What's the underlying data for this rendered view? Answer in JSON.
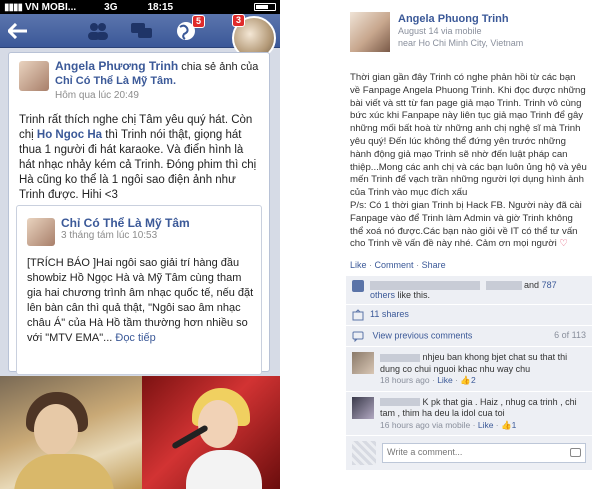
{
  "phone": {
    "status": {
      "carrier": "VN MOBI...",
      "network": "3G",
      "time": "18:15"
    },
    "badges": {
      "notifications": "5",
      "profile": "3"
    },
    "post": {
      "author": "Angela Phương Trinh",
      "action": "chia sẻ ảnh của",
      "page": "Chỉ Có Thể Là Mỹ Tâm.",
      "time": "Hôm qua lúc 20:49",
      "text_1": "Trinh rất thích nghe chị Tâm yêu quý hát. Còn chị",
      "text_highlight": "Ho Ngoc Ha",
      "text_2": "thì Trinh nói thật, giọng hát thua 1 người đi hát karaoke. Và điển hình là hát nhạc nhảy kém cả Trinh. Đóng phim thì chị Hà cũng ko thể là 1 ngôi sao điện ảnh như Trinh được. Hihi <3"
    },
    "shared": {
      "name": "Chỉ Có Thể Là Mỹ Tâm",
      "time": "3 tháng tám lúc 10:53",
      "text": "[TRÍCH BÁO ]Hai ngôi sao giải trí hàng đầu showbiz Hồ Ngọc Hà và Mỹ Tâm cùng tham gia hai chương trình âm nhạc quốc tế, nếu đặt lên bàn cân thì quả thật, \"Ngôi sao âm nhạc châu Á\" của Hà Hồ tầm thường hơn nhiều so với \"MTV EMA\"...",
      "more": "Đọc tiếp"
    }
  },
  "post": {
    "author": "Angela Phuong Trinh",
    "date": "August 14 via mobile",
    "location": "near Ho Chi Minh City, Vietnam",
    "body": "Thời gian gần đây Trinh có nghe phản hồi từ các bạn về Fanpage Angela Phuong Trinh. Khi đọc được những bài viết và stt từ fan page giả mạo Trinh. Trinh vô cùng bức xúc khi Fanpape này liên tục giả mạo Trinh để gây những mối bất hoà từ những anh chị nghệ sĩ mà Trinh yêu quý! Đến lúc không thể đứng yên trước những hành động giả mạo Trinh sẽ nhờ đến luật pháp can thiệp...Mong các anh chị và các bạn luôn ủng hộ và yêu mến Trinh để vạch trần những người lợi dụng hình ảnh của Trinh vào mục đích xấu",
    "ps": "P/s: Có 1 thời gian Trinh bị Hack FB. Người này đã cài Fanpage vào để Trinh làm Admin và giờ Trinh không thể xoá nó được.Các bạn nào giỏi về IT có thể tư vấn cho Trinh về vấn đề này nhé. Cảm ơn mọi người",
    "actions": {
      "like": "Like",
      "comment": "Comment",
      "share": "Share",
      "dot": "·"
    },
    "likes": {
      "and": "and",
      "count": "787",
      "others": "others",
      "tail": "like this."
    },
    "shares": "11 shares",
    "view_previous": "View previous comments",
    "comment_count": "6 of 113",
    "comments": [
      {
        "text": "nhjeu ban khong bjet chat su that thi dung co chui nguoi khac nhu way chu",
        "time": "18 hours ago",
        "likes": "2",
        "like": "Like",
        "via": ""
      },
      {
        "text": "K pk that gia . Haiz , nhug ca trinh , chi tam , thim ha deu la idol cua toi",
        "time": "16 hours ago via mobile",
        "likes": "1",
        "like": "Like",
        "via": ""
      }
    ],
    "write_placeholder": "Write a comment..."
  }
}
